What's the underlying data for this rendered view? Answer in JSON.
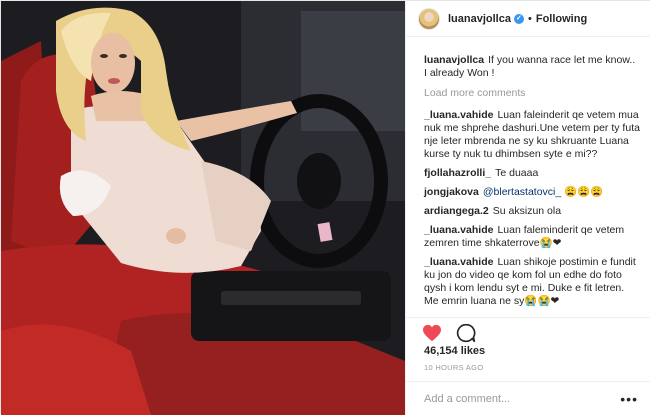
{
  "header": {
    "username": "luanavjollca",
    "verified_symbol": "✓",
    "separator": "•",
    "follow_status": "Following"
  },
  "caption": {
    "username": "luanavjollca",
    "text": "If you wanna race let me know..",
    "text2": "I already Won !"
  },
  "load_more": "Load more comments",
  "comments": [
    {
      "user": "_luana.vahide",
      "text": "Luan faleinderit qe vetem mua nuk me shprehe dashuri.Une vetem per ty futa nje leter mbrenda ne sy ku shkruante Luana kurse ty nuk tu dhimbsen syte e mi??"
    },
    {
      "user": "fjollahazrolli_",
      "text": "Te duaaa"
    },
    {
      "user": "jongjakova",
      "mention": "@blertastatovci_",
      "text": "😩😩😩"
    },
    {
      "user": "ardiangega.2",
      "text": "Su aksizun ola"
    },
    {
      "user": "_luana.vahide",
      "text": "Luan faleminderit qe vetem zemren time shkaterrove😭❤"
    },
    {
      "user": "_luana.vahide",
      "text": "Luan shikoje postimin e fundit ku jon do video qe kom fol un edhe do foto qysh i kom lendu syt e mi. Duke e fit letren. Me emrin luana ne sy😭😭❤"
    }
  ],
  "likes": "46,154 likes",
  "time": "10 HOURS AGO",
  "add_comment": {
    "placeholder": "Add a comment...",
    "more": "•••"
  },
  "icons": {
    "like": "heart-icon",
    "comment": "comment-icon",
    "options": "more-options-icon",
    "verified": "verified-badge-icon"
  },
  "colors": {
    "like_red": "#ed4956",
    "verified_blue": "#3897f0",
    "link": "#003569",
    "muted": "#999999"
  }
}
